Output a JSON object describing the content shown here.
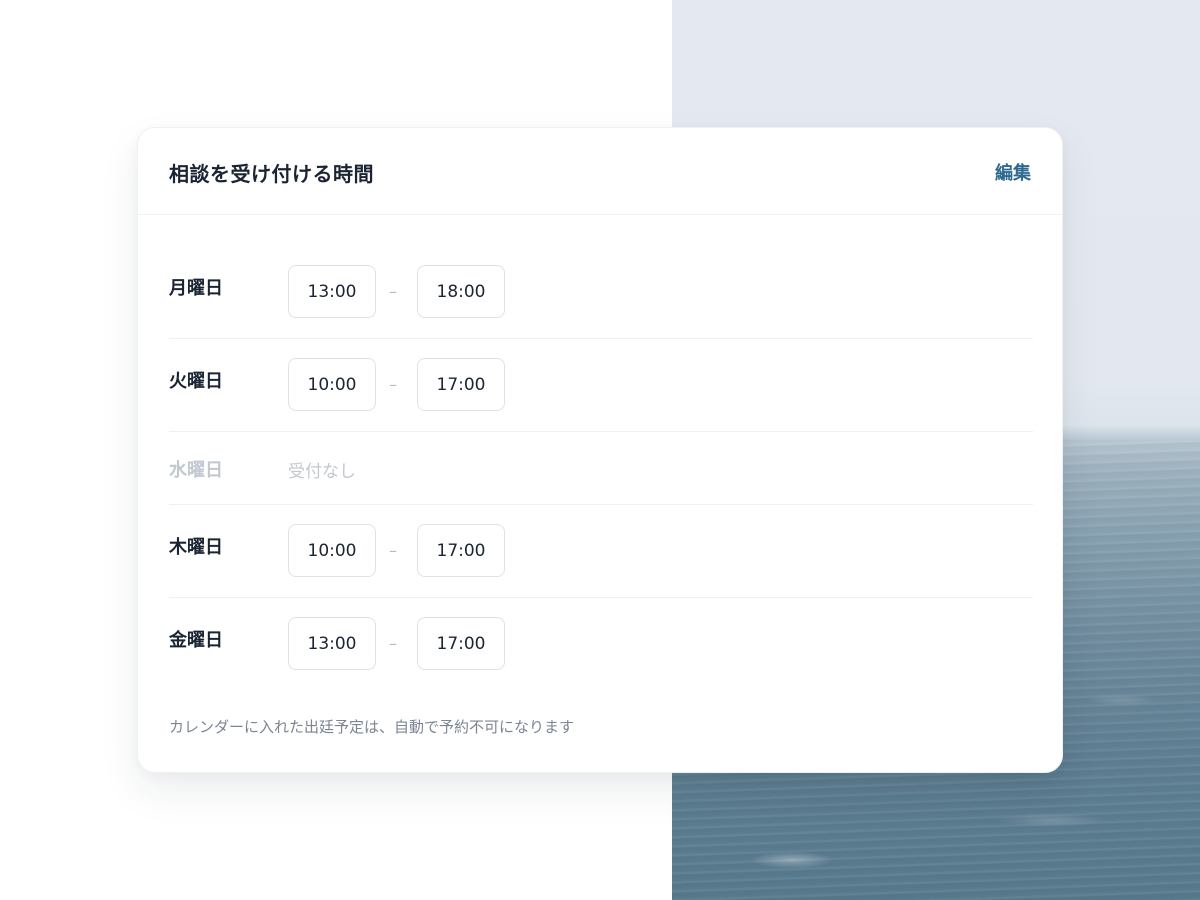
{
  "card": {
    "title": "相談を受け付ける時間",
    "edit_label": "編集",
    "footnote": "カレンダーに入れた出廷予定は、自動で予約不可になります"
  },
  "schedule": [
    {
      "day": "月曜日",
      "start": "13:00",
      "end": "18:00",
      "separator": "–"
    },
    {
      "day": "火曜日",
      "start": "10:00",
      "end": "17:00",
      "separator": "–"
    },
    {
      "day": "水曜日",
      "closed_label": "受付なし"
    },
    {
      "day": "木曜日",
      "start": "10:00",
      "end": "17:00",
      "separator": "–"
    },
    {
      "day": "金曜日",
      "start": "13:00",
      "end": "17:00",
      "separator": "–"
    }
  ],
  "colors": {
    "accent": "#2e6a8e",
    "text": "#1b2433",
    "muted": "#c2c8d0",
    "footnote": "#7b8594"
  }
}
